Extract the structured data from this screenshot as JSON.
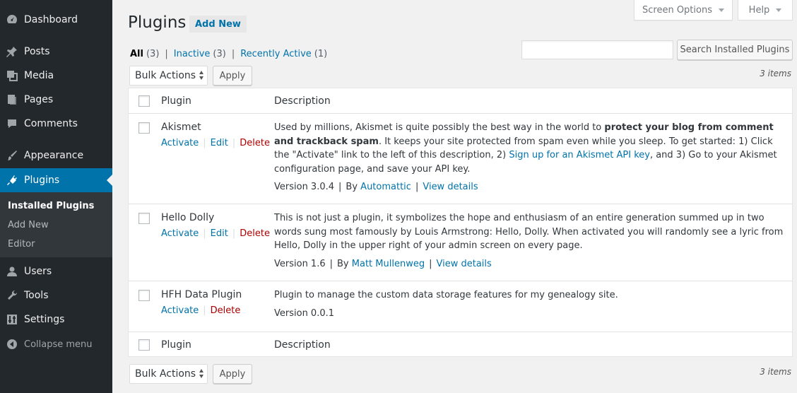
{
  "sidebar": {
    "items": [
      {
        "label": "Dashboard",
        "icon": "dashboard-icon"
      },
      {
        "label": "Posts",
        "icon": "pin-icon"
      },
      {
        "label": "Media",
        "icon": "media-icon"
      },
      {
        "label": "Pages",
        "icon": "pages-icon"
      },
      {
        "label": "Comments",
        "icon": "comment-icon"
      },
      {
        "label": "Appearance",
        "icon": "brush-icon"
      },
      {
        "label": "Plugins",
        "icon": "plug-icon"
      },
      {
        "label": "Users",
        "icon": "user-icon"
      },
      {
        "label": "Tools",
        "icon": "wrench-icon"
      },
      {
        "label": "Settings",
        "icon": "sliders-icon"
      }
    ],
    "submenu": [
      "Installed Plugins",
      "Add New",
      "Editor"
    ],
    "collapse_label": "Collapse menu"
  },
  "topbar": {
    "screen_options": "Screen Options",
    "help": "Help"
  },
  "header": {
    "title": "Plugins",
    "add_new": "Add New"
  },
  "filters": {
    "all": {
      "label": "All",
      "count": "(3)"
    },
    "inactive": {
      "label": "Inactive",
      "count": "(3)"
    },
    "recent": {
      "label": "Recently Active",
      "count": "(1)"
    }
  },
  "search": {
    "button": "Search Installed Plugins",
    "value": ""
  },
  "bulk": {
    "label": "Bulk Actions",
    "apply": "Apply",
    "items_count": "3 items"
  },
  "table": {
    "col_plugin": "Plugin",
    "col_description": "Description",
    "plugins": [
      {
        "name": "Akismet",
        "actions": [
          "Activate",
          "Edit",
          "Delete"
        ],
        "desc_1": "Used by millions, Akismet is quite possibly the best way in the world to ",
        "desc_bold": "protect your blog from comment and trackback spam",
        "desc_2": ". It keeps your site protected from spam even while you sleep. To get started: 1) Click the \"Activate\" link to the left of this description, 2) ",
        "desc_link": "Sign up for an Akismet API key",
        "desc_3": ", and 3) Go to your Akismet configuration page, and save your API key.",
        "version": "Version 3.0.4",
        "by": "By",
        "author": "Automattic",
        "details": "View details"
      },
      {
        "name": "Hello Dolly",
        "actions": [
          "Activate",
          "Edit",
          "Delete"
        ],
        "desc": "This is not just a plugin, it symbolizes the hope and enthusiasm of an entire generation summed up in two words sung most famously by Louis Armstrong: Hello, Dolly. When activated you will randomly see a lyric from Hello, Dolly in the upper right of your admin screen on every page.",
        "version": "Version 1.6",
        "by": "By",
        "author": "Matt Mullenweg",
        "details": "View details"
      },
      {
        "name": "HFH Data Plugin",
        "actions": [
          "Activate",
          "Delete"
        ],
        "desc": "Plugin to manage the custom data storage features for my genealogy site.",
        "version": "Version 0.0.1"
      }
    ]
  },
  "colors": {
    "sidebar_bg": "#23282d",
    "accent": "#0073aa",
    "delete": "#a00"
  }
}
